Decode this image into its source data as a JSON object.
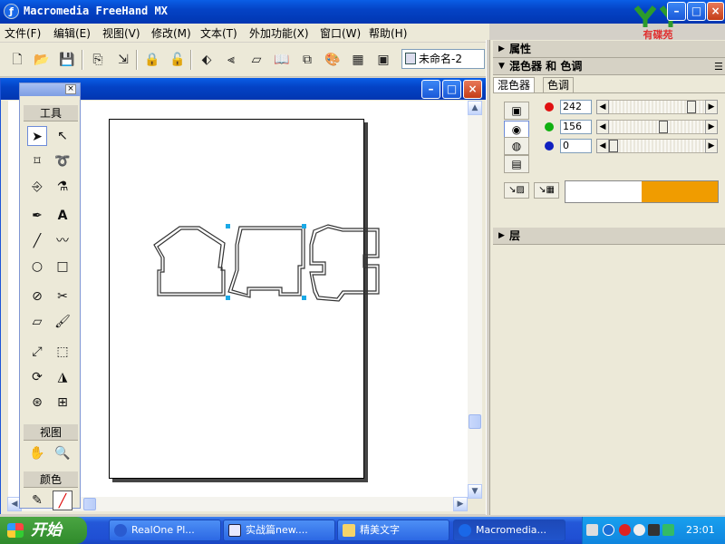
{
  "app": {
    "title": "Macromedia FreeHand MX"
  },
  "logo": {
    "text": "有碟苑"
  },
  "menu": [
    "文件(F)",
    "编辑(E)",
    "视图(V)",
    "修改(M)",
    "文本(T)",
    "外加功能(X)",
    "窗口(W)",
    "帮助(H)"
  ],
  "toolbar": {
    "document_name": "未命名-2"
  },
  "tools_panel": {
    "title": "工具",
    "view_label": "视图",
    "color_label": "颜色"
  },
  "right_panel": {
    "properties_label": "属性",
    "mixer_label": "混色器 和 色调",
    "tab_mixer": "混色器",
    "tab_tints": "色调",
    "red_value": "242",
    "green_value": "156",
    "blue_value": "0",
    "layers_label": "层",
    "swatch_color": "#f09c00"
  },
  "taskbar": {
    "start_label": "开始",
    "tasks": [
      "RealOne Pl...",
      "实战篇new....",
      "精美文字",
      "Macromedia..."
    ],
    "clock": "23:01"
  }
}
